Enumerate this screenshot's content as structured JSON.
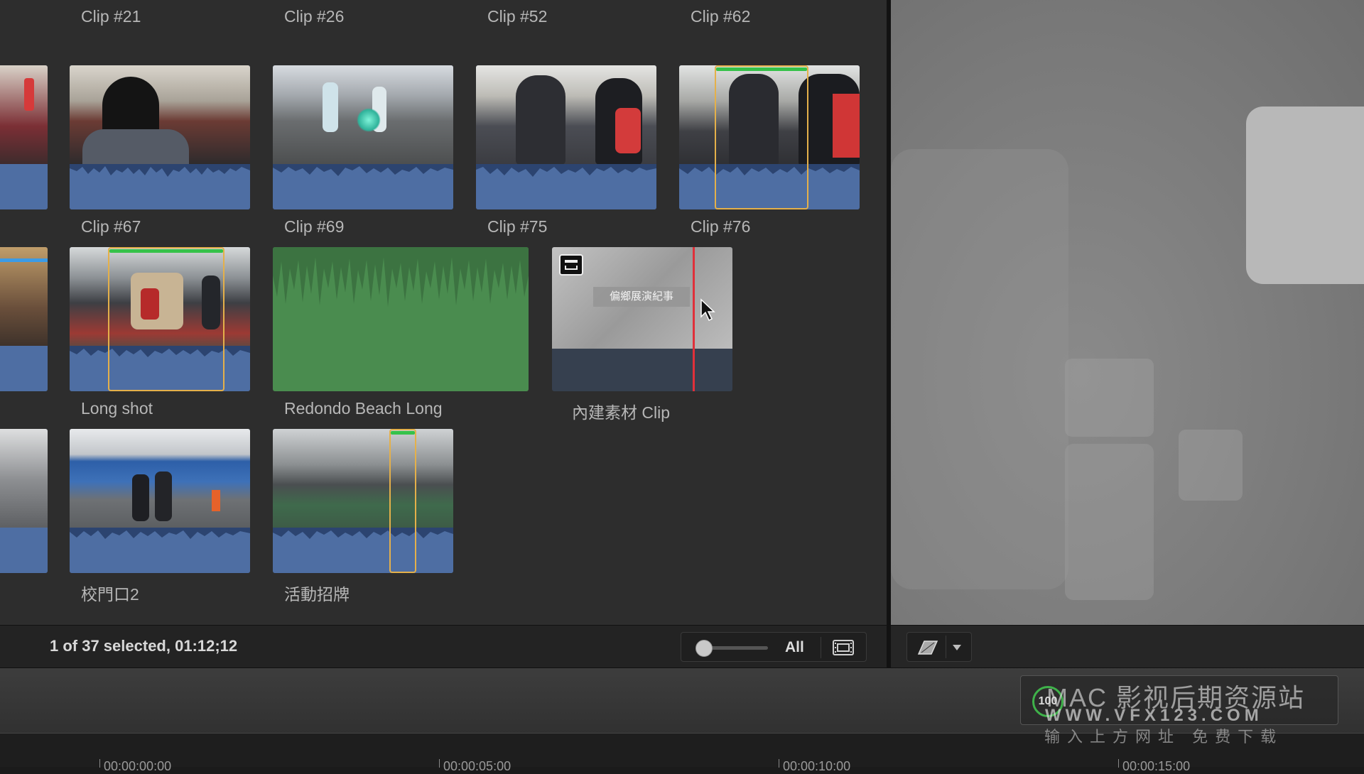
{
  "browser": {
    "clips": [
      {
        "label": "Clip #21"
      },
      {
        "label": "Clip #26"
      },
      {
        "label": "Clip #52"
      },
      {
        "label": "Clip #62"
      },
      {
        "label": "Clip #67"
      },
      {
        "label": "Clip #69"
      },
      {
        "label": "Clip #75"
      },
      {
        "label": "Clip #76"
      },
      {
        "label": "Long shot"
      },
      {
        "label": "Redondo Beach Long"
      },
      {
        "label": "內建素材 Clip",
        "overlay_text": "偏鄉展演紀事"
      },
      {
        "label": "校門口2"
      },
      {
        "label": "活動招牌"
      }
    ]
  },
  "status": {
    "selection_text": "1 of 37 selected, 01:12;12"
  },
  "zoom": {
    "filter_label": "All"
  },
  "timeline": {
    "ruler_ticks": [
      "00:00:00:00",
      "00:00:05:00",
      "00:00:10:00",
      "00:00:15:00"
    ]
  },
  "watermark": {
    "title": "MAC 影视后期资源站",
    "url": "WWW.VFX123.COM",
    "subtitle": "输入上方网址 免费下载",
    "badge": "100"
  },
  "colors": {
    "waveform_blue": "#4e6ea3",
    "audio_green": "#4a8c4f",
    "selection_yellow": "#e4b04a",
    "playhead_red": "#e0303a"
  }
}
